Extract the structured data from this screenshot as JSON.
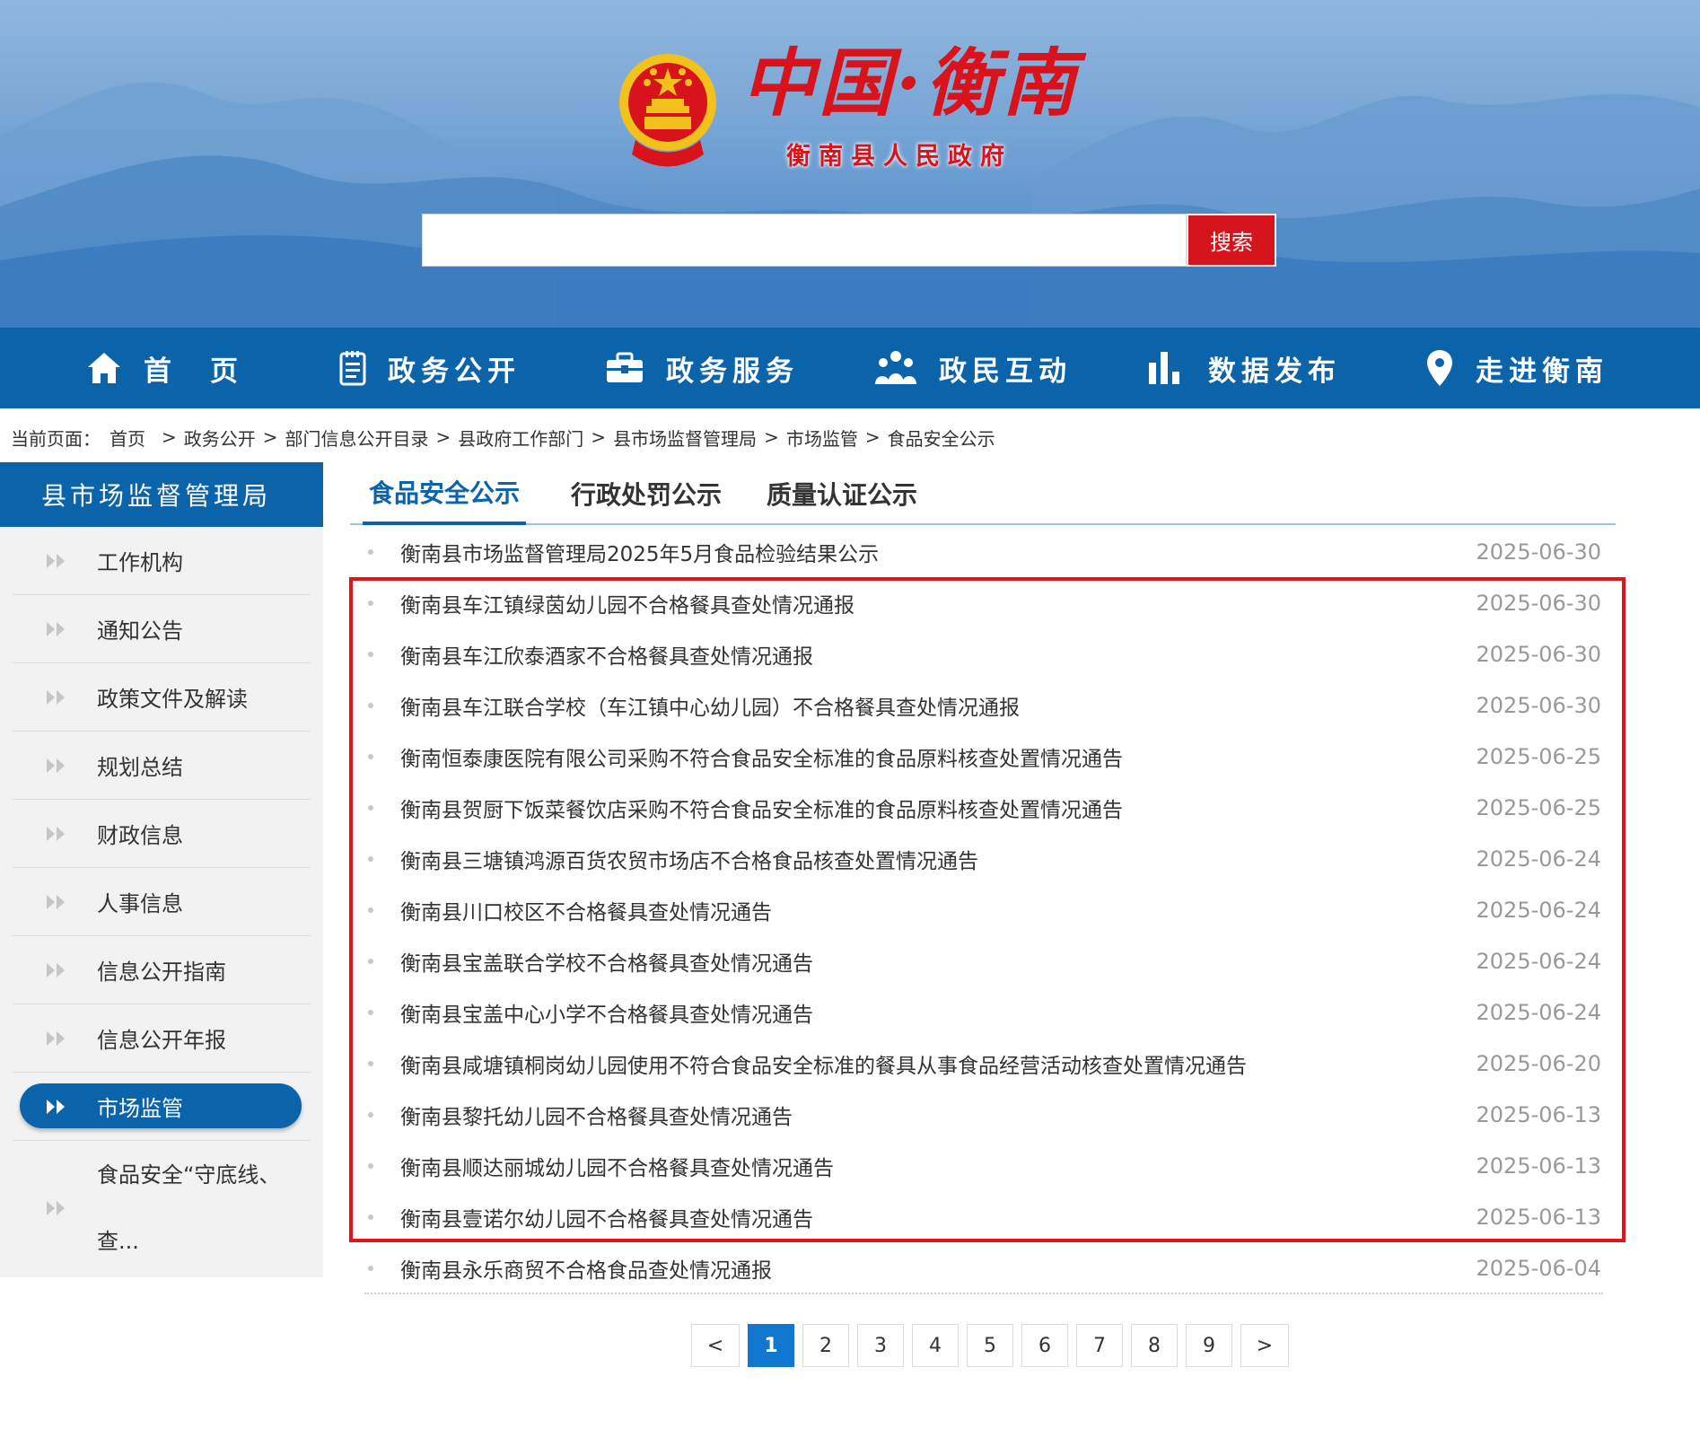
{
  "header": {
    "title": "中国·衡南",
    "subtitle": "衡南县人民政府",
    "search": {
      "value": "",
      "placeholder": "",
      "button_label": "搜索"
    }
  },
  "nav": [
    {
      "label": "首　页",
      "icon": "home-icon"
    },
    {
      "label": "政务公开",
      "icon": "notepad-icon"
    },
    {
      "label": "政务服务",
      "icon": "briefcase-icon"
    },
    {
      "label": "政民互动",
      "icon": "people-icon"
    },
    {
      "label": "数据发布",
      "icon": "bar-chart-icon"
    },
    {
      "label": "走进衡南",
      "icon": "location-pin-icon"
    }
  ],
  "breadcrumb": {
    "prefix": "当前页面：",
    "items": [
      "首页",
      "政务公开",
      "部门信息公开目录",
      "县政府工作部门",
      "县市场监督管理局",
      "市场监管",
      "食品安全公示"
    ]
  },
  "sidebar": {
    "title": "县市场监督管理局",
    "items": [
      {
        "label": "工作机构"
      },
      {
        "label": "通知公告"
      },
      {
        "label": "政策文件及解读"
      },
      {
        "label": "规划总结"
      },
      {
        "label": "财政信息"
      },
      {
        "label": "人事信息"
      },
      {
        "label": "信息公开指南"
      },
      {
        "label": "信息公开年报"
      },
      {
        "label": "市场监管",
        "active": true
      },
      {
        "label": "食品安全“守底线、查..."
      }
    ]
  },
  "tabs": [
    {
      "label": "食品安全公示",
      "active": true
    },
    {
      "label": "行政处罚公示"
    },
    {
      "label": "质量认证公示"
    }
  ],
  "list": [
    {
      "title": "衡南县市场监督管理局2025年5月食品检验结果公示",
      "date": "2025-06-30"
    },
    {
      "title": "衡南县车江镇绿茵幼儿园不合格餐具查处情况通报",
      "date": "2025-06-30"
    },
    {
      "title": "衡南县车江欣泰酒家不合格餐具查处情况通报",
      "date": "2025-06-30"
    },
    {
      "title": "衡南县车江联合学校（车江镇中心幼儿园）不合格餐具查处情况通报",
      "date": "2025-06-30"
    },
    {
      "title": "衡南恒泰康医院有限公司采购不符合食品安全标准的食品原料核查处置情况通告",
      "date": "2025-06-25"
    },
    {
      "title": "衡南县贺厨下饭菜餐饮店采购不符合食品安全标准的食品原料核查处置情况通告",
      "date": "2025-06-25"
    },
    {
      "title": "衡南县三塘镇鸿源百货农贸市场店不合格食品核查处置情况通告",
      "date": "2025-06-24"
    },
    {
      "title": "衡南县川口校区不合格餐具查处情况通告",
      "date": "2025-06-24"
    },
    {
      "title": "衡南县宝盖联合学校不合格餐具查处情况通告",
      "date": "2025-06-24"
    },
    {
      "title": "衡南县宝盖中心小学不合格餐具查处情况通告",
      "date": "2025-06-24"
    },
    {
      "title": "衡南县咸塘镇桐岗幼儿园使用不符合食品安全标准的餐具从事食品经营活动核查处置情况通告",
      "date": "2025-06-20"
    },
    {
      "title": "衡南县黎托幼儿园不合格餐具查处情况通告",
      "date": "2025-06-13"
    },
    {
      "title": "衡南县顺达丽城幼儿园不合格餐具查处情况通告",
      "date": "2025-06-13"
    },
    {
      "title": "衡南县壹诺尔幼儿园不合格餐具查处情况通告",
      "date": "2025-06-13"
    },
    {
      "title": "衡南县永乐商贸不合格食品查处情况通报",
      "date": "2025-06-04"
    }
  ],
  "pagination": {
    "prev": "<",
    "next": ">",
    "pages": [
      "1",
      "2",
      "3",
      "4",
      "5",
      "6",
      "7",
      "8",
      "9"
    ],
    "current": "1"
  },
  "colors": {
    "primary": "#0b63aa",
    "accent_red": "#d6141c",
    "date_gray": "#999999"
  }
}
